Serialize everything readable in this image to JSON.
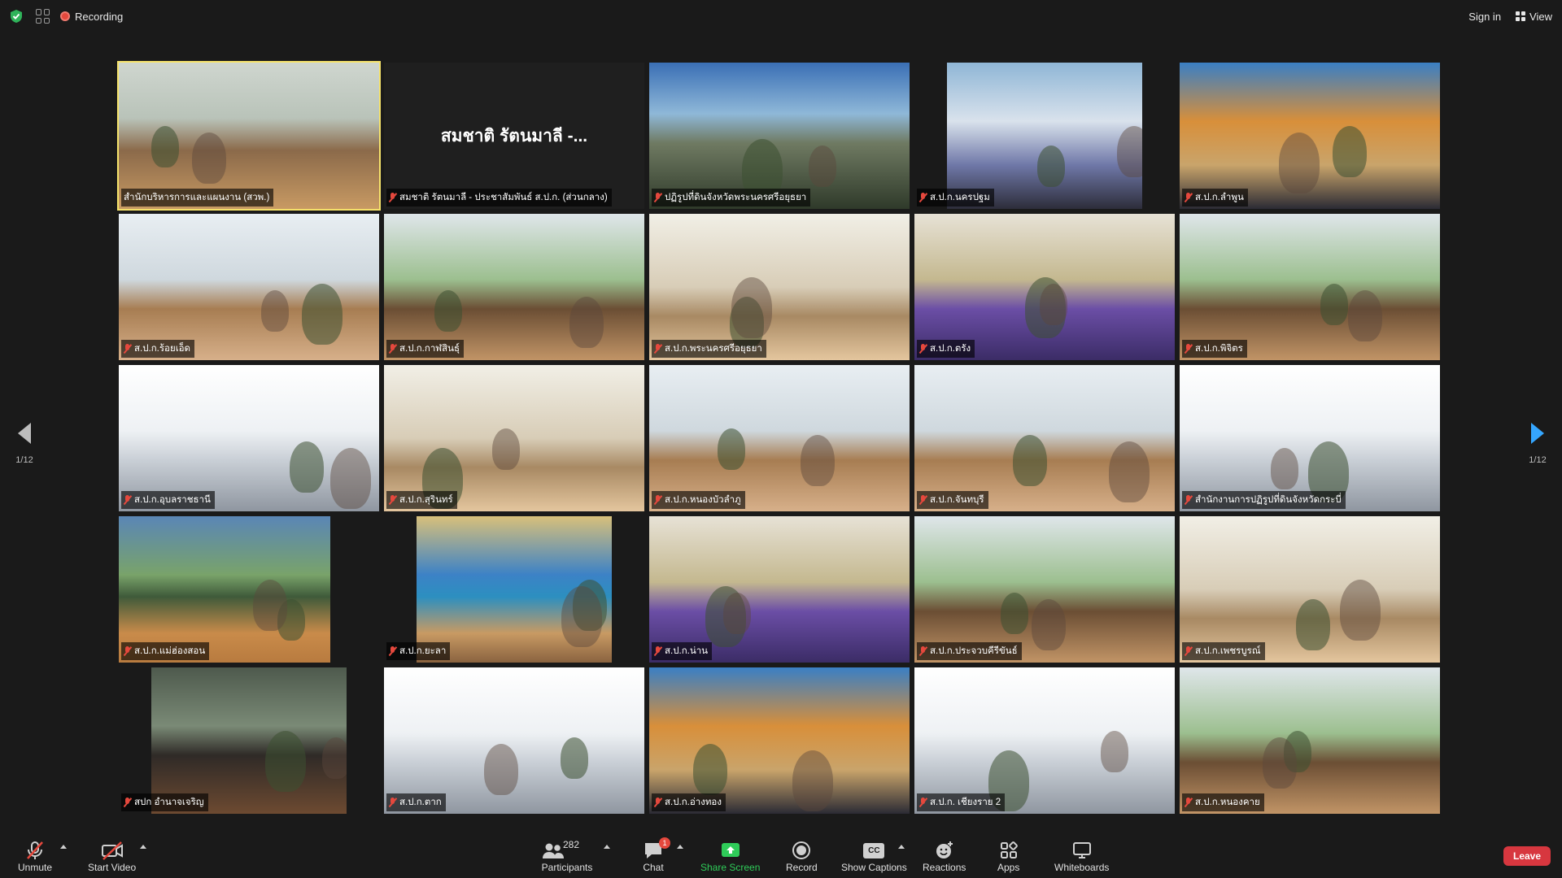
{
  "topbar": {
    "recording_label": "Recording",
    "signin_label": "Sign in",
    "view_label": "View"
  },
  "gallery": {
    "page_indicator_left": "1/12",
    "page_indicator_right": "1/12",
    "tiles": [
      {
        "name": "สำนักบริหารการและแผนงาน (สวพ.)",
        "muted": false,
        "active": true,
        "scene": "room"
      },
      {
        "name": "สมชาติ รัตนมาลี - ประชาสัมพันธ์ ส.ป.ก. (ส่วนกลาง)",
        "display_name": "สมชาติ รัตนมาลี -...",
        "muted": true,
        "video": false
      },
      {
        "name": "ปฏิรูปที่ดินจังหวัดพระนครศรีอยุธยา",
        "muted": true,
        "scene": "temple"
      },
      {
        "name": "ส.ป.ก.นครปฐม",
        "muted": true,
        "scene": "blue"
      },
      {
        "name": "ส.ป.ก.ลำพูน",
        "muted": true,
        "scene": "gold"
      },
      {
        "name": "ส.ป.ก.ร้อยเอ็ด",
        "muted": true,
        "scene": "office"
      },
      {
        "name": "ส.ป.ก.กาฬสินธุ์",
        "muted": true,
        "scene": "green"
      },
      {
        "name": "ส.ป.ก.พระนครศรีอยุธยา",
        "muted": true,
        "scene": "wall"
      },
      {
        "name": "ส.ป.ก.ตรัง",
        "muted": true,
        "scene": "purple"
      },
      {
        "name": "ส.ป.ก.พิจิตร",
        "muted": true,
        "scene": "green"
      },
      {
        "name": "ส.ป.ก.อุบลราชธานี",
        "muted": true,
        "scene": "bright"
      },
      {
        "name": "ส.ป.ก.สุรินทร์",
        "muted": true,
        "scene": "wall"
      },
      {
        "name": "ส.ป.ก.หนองบัวลำภู",
        "muted": true,
        "scene": "office"
      },
      {
        "name": "ส.ป.ก.จันทบุรี",
        "muted": true,
        "scene": "office"
      },
      {
        "name": "สำนักงานการปฏิรูปที่ดินจังหวัดกระบี่",
        "muted": true,
        "scene": "bright"
      },
      {
        "name": "ส.ป.ก.แม่ฮ่องสอน",
        "muted": true,
        "scene": "lake"
      },
      {
        "name": "ส.ป.ก.ยะลา",
        "muted": true,
        "scene": "poster"
      },
      {
        "name": "ส.ป.ก.น่าน",
        "muted": true,
        "scene": "purple"
      },
      {
        "name": "ส.ป.ก.ประจวบคีรีขันธ์",
        "muted": true,
        "scene": "green"
      },
      {
        "name": "ส.ป.ก.เพชรบูรณ์",
        "muted": true,
        "scene": "wall"
      },
      {
        "name": "สปก อำนาจเจริญ",
        "muted": true,
        "scene": "darkroom"
      },
      {
        "name": "ส.ป.ก.ตาก",
        "muted": true,
        "scene": "bright"
      },
      {
        "name": "ส.ป.ก.อ่างทอง",
        "muted": true,
        "scene": "gold"
      },
      {
        "name": "ส.ป.ก. เชียงราย 2",
        "muted": true,
        "scene": "bright"
      },
      {
        "name": "ส.ป.ก.หนองคาย",
        "muted": true,
        "scene": "green"
      }
    ]
  },
  "toolbar": {
    "unmute_label": "Unmute",
    "start_video_label": "Start Video",
    "participants_label": "Participants",
    "participants_count": "282",
    "chat_label": "Chat",
    "chat_badge": "1",
    "share_screen_label": "Share Screen",
    "record_label": "Record",
    "captions_label": "Show Captions",
    "captions_icon_text": "CC",
    "reactions_label": "Reactions",
    "apps_label": "Apps",
    "whiteboards_label": "Whiteboards",
    "leave_label": "Leave"
  },
  "colors": {
    "background": "#1a1a1a",
    "active_speaker": "#f6e36b",
    "muted_red": "#e5483d",
    "share_green": "#2fcc59",
    "leave_red": "#d7373f",
    "nav_blue": "#35a6ff"
  }
}
